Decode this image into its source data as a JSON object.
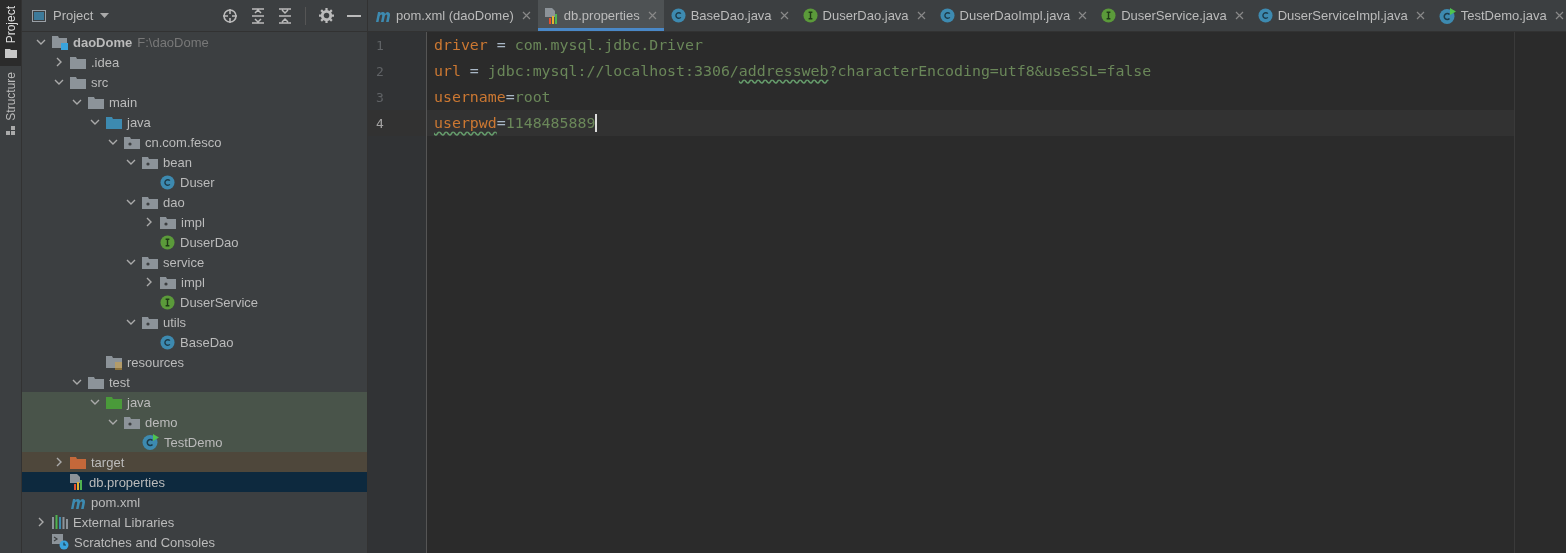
{
  "tool_strip": [
    {
      "label": "Project",
      "kind": "project",
      "selected": true
    },
    {
      "label": "Structure",
      "kind": "structure",
      "selected": false
    }
  ],
  "project_panel": {
    "title": "Project"
  },
  "tree": [
    {
      "label": "daoDome",
      "hint": "F:\\daoDome",
      "kind": "module",
      "expanded": true,
      "selected": false,
      "children": [
        {
          "label": ".idea",
          "kind": "folder",
          "expanded": false,
          "selected": false
        },
        {
          "label": "src",
          "kind": "folder",
          "expanded": true,
          "selected": false,
          "children": [
            {
              "label": "main",
              "kind": "folder",
              "expanded": true,
              "selected": false,
              "children": [
                {
                  "label": "java",
                  "kind": "source",
                  "expanded": true,
                  "selected": false,
                  "children": [
                    {
                      "label": "cn.com.fesco",
                      "kind": "package",
                      "expanded": true,
                      "selected": false,
                      "children": [
                        {
                          "label": "bean",
                          "kind": "package",
                          "expanded": true,
                          "selected": false,
                          "children": [
                            {
                              "label": "Duser",
                              "kind": "class",
                              "selected": false
                            }
                          ]
                        },
                        {
                          "label": "dao",
                          "kind": "package",
                          "expanded": true,
                          "selected": false,
                          "children": [
                            {
                              "label": "impl",
                              "kind": "package",
                              "expanded": false,
                              "selected": false
                            },
                            {
                              "label": "DuserDao",
                              "kind": "interface",
                              "selected": false
                            }
                          ]
                        },
                        {
                          "label": "service",
                          "kind": "package",
                          "expanded": true,
                          "selected": false,
                          "children": [
                            {
                              "label": "impl",
                              "kind": "package",
                              "expanded": false,
                              "selected": false
                            },
                            {
                              "label": "DuserService",
                              "kind": "interface",
                              "selected": false
                            }
                          ]
                        },
                        {
                          "label": "utils",
                          "kind": "package",
                          "expanded": true,
                          "selected": false,
                          "children": [
                            {
                              "label": "BaseDao",
                              "kind": "class",
                              "selected": false
                            }
                          ]
                        }
                      ]
                    }
                  ]
                },
                {
                  "label": "resources",
                  "kind": "resources",
                  "selected": false
                }
              ]
            },
            {
              "label": "test",
              "kind": "folder",
              "expanded": true,
              "selected": false,
              "children": [
                {
                  "label": "java",
                  "kind": "test-source",
                  "test_scope": true,
                  "expanded": true,
                  "selected": false,
                  "children": [
                    {
                      "label": "demo",
                      "kind": "package",
                      "test_scope": true,
                      "expanded": true,
                      "selected": false,
                      "children": [
                        {
                          "label": "TestDemo",
                          "kind": "test-class",
                          "test_scope": true,
                          "selected": false
                        }
                      ]
                    }
                  ]
                }
              ]
            }
          ]
        },
        {
          "label": "target",
          "kind": "excluded",
          "excluded": true,
          "expanded": false,
          "selected": false
        },
        {
          "label": "db.properties",
          "kind": "properties",
          "selected": true
        },
        {
          "label": "pom.xml",
          "kind": "maven",
          "selected": false
        }
      ]
    },
    {
      "label": "External Libraries",
      "kind": "libraries",
      "expanded": false,
      "selected": false
    },
    {
      "label": "Scratches and Consoles",
      "kind": "scratches",
      "selected": false
    }
  ],
  "tabs": [
    {
      "label": "pom.xml (daoDome)",
      "kind": "maven",
      "selected": false
    },
    {
      "label": "db.properties",
      "kind": "properties",
      "selected": true
    },
    {
      "label": "BaseDao.java",
      "kind": "class",
      "selected": false
    },
    {
      "label": "DuserDao.java",
      "kind": "interface",
      "selected": false
    },
    {
      "label": "DuserDaoImpl.java",
      "kind": "class",
      "selected": false
    },
    {
      "label": "DuserService.java",
      "kind": "interface",
      "selected": false
    },
    {
      "label": "DuserServiceImpl.java",
      "kind": "class",
      "selected": false
    },
    {
      "label": "TestDemo.java",
      "kind": "test-class",
      "selected": false
    }
  ],
  "editor": {
    "lines": [
      {
        "number": "1",
        "current": false,
        "tokens": [
          {
            "text": "driver",
            "kind": "key",
            "typo": false
          },
          {
            "text": " = ",
            "kind": "op",
            "typo": false
          },
          {
            "text": "com.mysql.jdbc.Driver",
            "kind": "value",
            "typo": false
          }
        ]
      },
      {
        "number": "2",
        "current": false,
        "tokens": [
          {
            "text": "url",
            "kind": "key",
            "typo": false
          },
          {
            "text": " = ",
            "kind": "op",
            "typo": false
          },
          {
            "text": "jdbc:mysql://localhost:3306/",
            "kind": "value",
            "typo": false
          },
          {
            "text": "addressweb",
            "kind": "value",
            "typo": true
          },
          {
            "text": "?characterEncoding=utf8&useSSL=false",
            "kind": "value",
            "typo": false
          }
        ]
      },
      {
        "number": "3",
        "current": false,
        "tokens": [
          {
            "text": "username",
            "kind": "key",
            "typo": false
          },
          {
            "text": "=",
            "kind": "op",
            "typo": false
          },
          {
            "text": "root",
            "kind": "value",
            "typo": false
          }
        ]
      },
      {
        "number": "4",
        "current": true,
        "tokens": [
          {
            "text": "userpwd",
            "kind": "key",
            "typo": true
          },
          {
            "text": "=",
            "kind": "op",
            "typo": false
          },
          {
            "text": "1148485889",
            "kind": "value",
            "typo": false
          }
        ]
      }
    ]
  }
}
